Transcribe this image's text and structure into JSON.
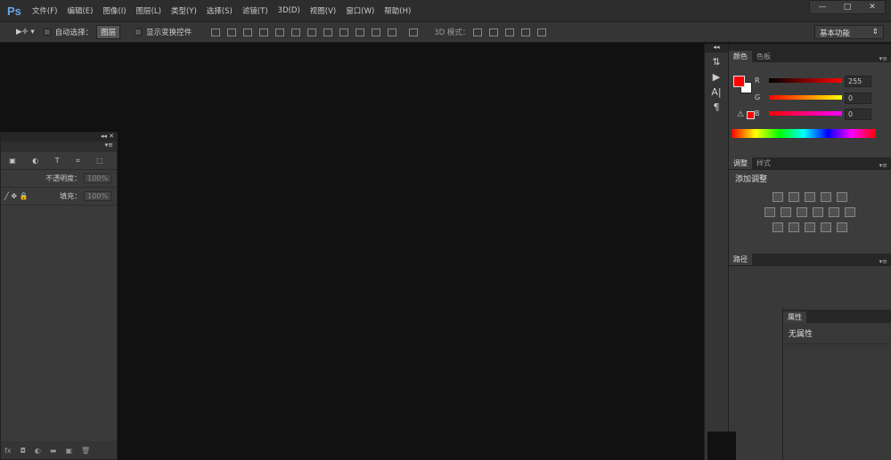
{
  "app": {
    "logo": "Ps"
  },
  "menu": [
    "文件(F)",
    "编辑(E)",
    "图像(I)",
    "图层(L)",
    "类型(Y)",
    "选择(S)",
    "滤镜(T)",
    "3D(D)",
    "视图(V)",
    "窗口(W)",
    "帮助(H)"
  ],
  "window_controls": {
    "minimize": "—",
    "maximize": "□",
    "close": "✕"
  },
  "options": {
    "tool_icon": "▶✛ ▾",
    "auto_select": "自动选择：",
    "auto_select_value": "图层",
    "show_transform": "显示变换控件",
    "mode_3d": "3D 模式：",
    "workspace": "基本功能"
  },
  "layers_panel": {
    "opacity_label": "不透明度：",
    "opacity": "100%",
    "fill_label": "填充：",
    "fill": "100%",
    "footer_icons": [
      "fx",
      "◘",
      "◐",
      "▬",
      "▣",
      "🗑"
    ]
  },
  "color_panel": {
    "tabs": [
      "颜色",
      "色板"
    ],
    "r_label": "R",
    "g_label": "G",
    "b_label": "B",
    "r": "255",
    "g": "0",
    "b": "0",
    "foreground": "#ff0000",
    "background": "#ffffff"
  },
  "adjust_panel": {
    "tabs": [
      "调整",
      "样式"
    ],
    "title": "添加调整"
  },
  "paths_panel": {
    "tab": "路径"
  },
  "properties_panel": {
    "tab": "属性",
    "text": "无属性"
  },
  "toolcol": [
    "⇅",
    "▶",
    "A|",
    "¶"
  ]
}
